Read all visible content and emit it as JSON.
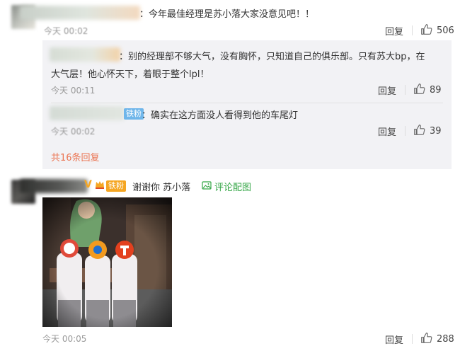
{
  "comments": [
    {
      "text": "：今年最佳经理是苏小落大家没意见吧！！",
      "time": "今天 00:02",
      "reply_label": "回复",
      "likes": "506"
    },
    {
      "text": "谢谢你 苏小落",
      "time": "今天 00:05",
      "reply_label": "回复",
      "likes": "288",
      "badge": "铁粉",
      "pic_link": "评论配图"
    }
  ],
  "replies": [
    {
      "line1": "：别的经理部不够大气，没有胸怀，只知道自己的俱乐部。只有苏大bp，在",
      "line2": "大气层！他心怀天下，着眼于整个lpl！",
      "time": "今天 00:11",
      "reply_label": "回复",
      "likes": "89"
    },
    {
      "text": "：确实在这方面没人看得到他的车尾灯",
      "time": "今天 00:02",
      "reply_label": "回复",
      "likes": "39",
      "badge": "铁粉"
    }
  ],
  "more_replies": "共16条回复",
  "colors": {
    "accent_orange": "#eb7350",
    "link_green": "#33a645",
    "badge_orange": "#f5a623",
    "badge_blue": "#6fb6ea",
    "reply_bg": "#f2f2f5"
  }
}
